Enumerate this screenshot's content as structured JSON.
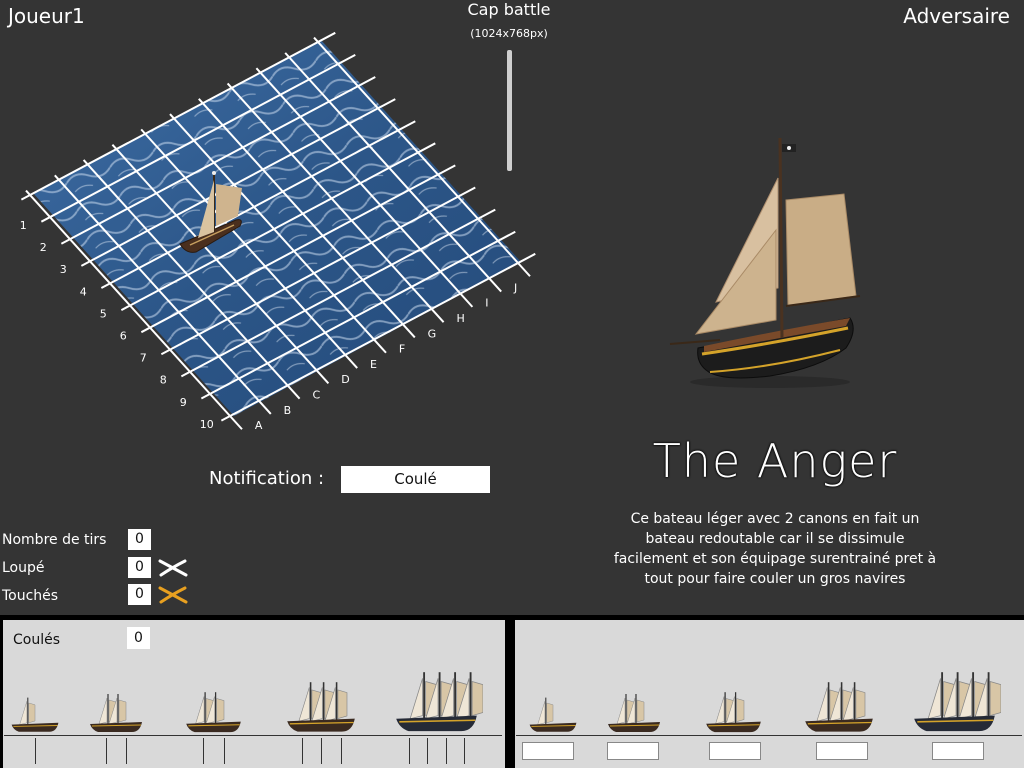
{
  "header": {
    "player_name": "Joueur1",
    "opponent_name": "Adversaire",
    "game_title": "Cap battle",
    "game_size": "(1024x768px)"
  },
  "grid": {
    "row_labels": [
      "1",
      "2",
      "3",
      "4",
      "5",
      "6",
      "7",
      "8",
      "9",
      "10"
    ],
    "col_labels": [
      "A",
      "B",
      "C",
      "D",
      "E",
      "F",
      "G",
      "H",
      "I",
      "J"
    ],
    "water_color": "#2f5a8c",
    "grid_line_color": "#ffffff"
  },
  "notification": {
    "label": "Notification :",
    "value": "Coulé"
  },
  "stats": {
    "shots_label": "Nombre de tirs",
    "shots_value": "0",
    "missed_label": "Loupé",
    "missed_value": "0",
    "missed_icon": "white-cross-icon",
    "hits_label": "Touchés",
    "hits_value": "0",
    "hits_icon": "orange-cross-icon",
    "hits_color": "#e8a020",
    "sunk_label": "Coulés",
    "sunk_value": "0"
  },
  "selected_ship": {
    "name": "The Anger",
    "description": "Ce bateau léger avec 2 canons en fait un bateau redoutable car il se dissimule facilement et son équipage surentrainé pret à tout pour faire couler un gros navires"
  },
  "player_fleet": [
    {
      "icon": "sloop-ship-icon",
      "size": 1
    },
    {
      "icon": "schooner-ship-icon",
      "size": 2
    },
    {
      "icon": "brig-ship-icon",
      "size": 2
    },
    {
      "icon": "frigate-ship-icon",
      "size": 3
    },
    {
      "icon": "galleon-ship-icon",
      "size": 4
    }
  ],
  "opponent_fleet": [
    {
      "icon": "sloop-ship-icon",
      "name_value": ""
    },
    {
      "icon": "schooner-ship-icon",
      "name_value": ""
    },
    {
      "icon": "brig-ship-icon",
      "name_value": ""
    },
    {
      "icon": "frigate-ship-icon",
      "name_value": ""
    },
    {
      "icon": "galleon-ship-icon",
      "name_value": ""
    }
  ]
}
